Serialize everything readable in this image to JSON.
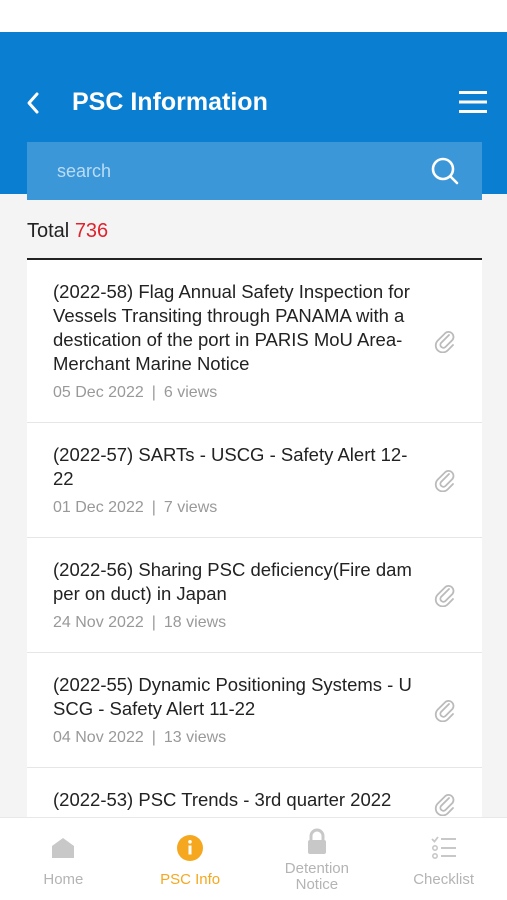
{
  "header": {
    "title": "PSC Information"
  },
  "search": {
    "placeholder": "search"
  },
  "total": {
    "label": "Total",
    "count": "736"
  },
  "items": [
    {
      "title": "(2022-58) Flag Annual Safety Inspection for Vessels Transiting through PANAMA with a destication of the port in PARIS MoU Area- Merchant Marine Notice",
      "date": "05 Dec 2022",
      "views": "6 views"
    },
    {
      "title": "(2022-57) SARTs - USCG - Safety Alert 12-22",
      "date": "01 Dec 2022",
      "views": "7 views"
    },
    {
      "title": "(2022-56) Sharing PSC deficiency(Fire damper on duct) in Japan",
      "date": "24 Nov 2022",
      "views": "18 views"
    },
    {
      "title": "(2022-55) Dynamic Positioning Systems - USCG - Safety Alert 11-22",
      "date": "04 Nov 2022",
      "views": "13 views"
    },
    {
      "title": "(2022-53) PSC Trends - 3rd quarter 2022",
      "date": "",
      "views": ""
    }
  ],
  "meta_separator": "|",
  "tabs": [
    {
      "label": "Home",
      "icon": "home-icon"
    },
    {
      "label": "PSC Info",
      "icon": "info-icon",
      "active": true
    },
    {
      "label": "Detention Notice",
      "icon": "lock-icon"
    },
    {
      "label": "Checklist",
      "icon": "checklist-icon"
    }
  ],
  "colors": {
    "header": "#0a7ed0",
    "accent_active": "#f5a81f",
    "total_count": "#e0232e"
  }
}
